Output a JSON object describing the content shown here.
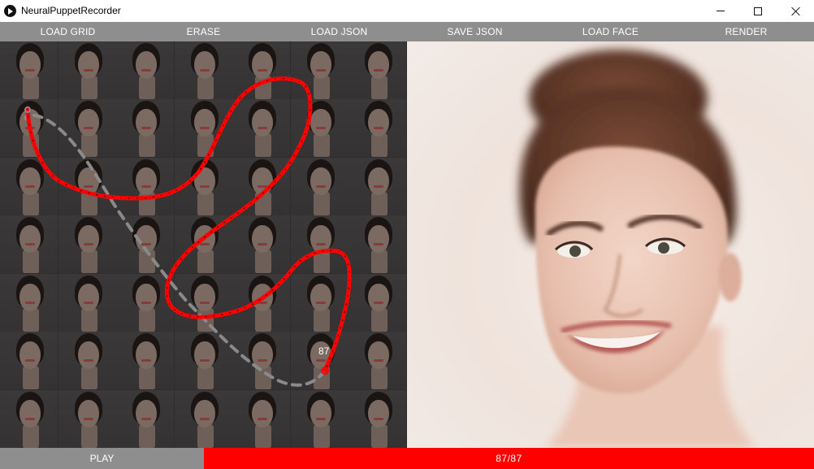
{
  "window": {
    "title": "NeuralPuppetRecorder",
    "controls": [
      "minimize-icon",
      "maximize-icon",
      "close-icon"
    ]
  },
  "menu": {
    "items": [
      {
        "label": "LOAD GRID"
      },
      {
        "label": "ERASE"
      },
      {
        "label": "LOAD JSON"
      },
      {
        "label": "SAVE JSON"
      },
      {
        "label": "LOAD FACE"
      },
      {
        "label": "RENDER"
      }
    ]
  },
  "canvas": {
    "grid_columns": 7,
    "grid_rows": 7,
    "current_frame_label": "87",
    "path_color": "#ff0000",
    "return_path_color": "#8a8a8a"
  },
  "playback": {
    "play_label": "PLAY",
    "progress_text": "87/87",
    "current_frame": 87,
    "total_frames": 87,
    "progress_fraction": 1.0,
    "progress_color": "#ff0000"
  },
  "colors": {
    "menu_bg": "#8e8e8e",
    "panel_bg": "#2e2c2c"
  }
}
